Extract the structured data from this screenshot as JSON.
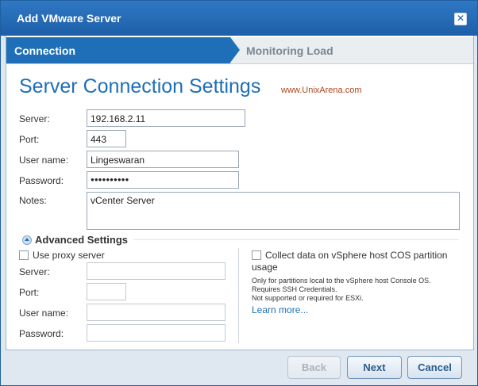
{
  "window": {
    "title": "Add VMware Server"
  },
  "wizard": {
    "steps": [
      "Connection",
      "Monitoring Load"
    ],
    "active_step": "Connection"
  },
  "page": {
    "heading": "Server Connection Settings",
    "watermark": "www.UnixArena.com"
  },
  "connection": {
    "server_label": "Server:",
    "server_value": "192.168.2.11",
    "port_label": "Port:",
    "port_value": "443",
    "username_label": "User name:",
    "username_value": "Lingeswaran",
    "password_label": "Password:",
    "password_value": "●●●●●●●●●●",
    "notes_label": "Notes:",
    "notes_value": "vCenter Server"
  },
  "advanced": {
    "title": "Advanced Settings",
    "proxy_checkbox_label": "Use proxy server",
    "proxy": {
      "server_label": "Server:",
      "port_label": "Port:",
      "username_label": "User name:",
      "password_label": "Password:"
    },
    "cos_checkbox_label_line1": "Collect data on vSphere host COS partition",
    "cos_checkbox_label_line2": "usage",
    "cos_note_line1": "Only for partitions local to the vSphere host Console OS.",
    "cos_note_line2": "Requires SSH Credentials.",
    "cos_note_line3": "Not supported or required for ESXi.",
    "learn_more": "Learn more..."
  },
  "buttons": {
    "back": "Back",
    "next": "Next",
    "cancel": "Cancel",
    "close_glyph": "✕"
  },
  "colors": {
    "titlebar": "#1d5fa8",
    "accent": "#1e6fb8",
    "watermark": "#b0421c"
  }
}
